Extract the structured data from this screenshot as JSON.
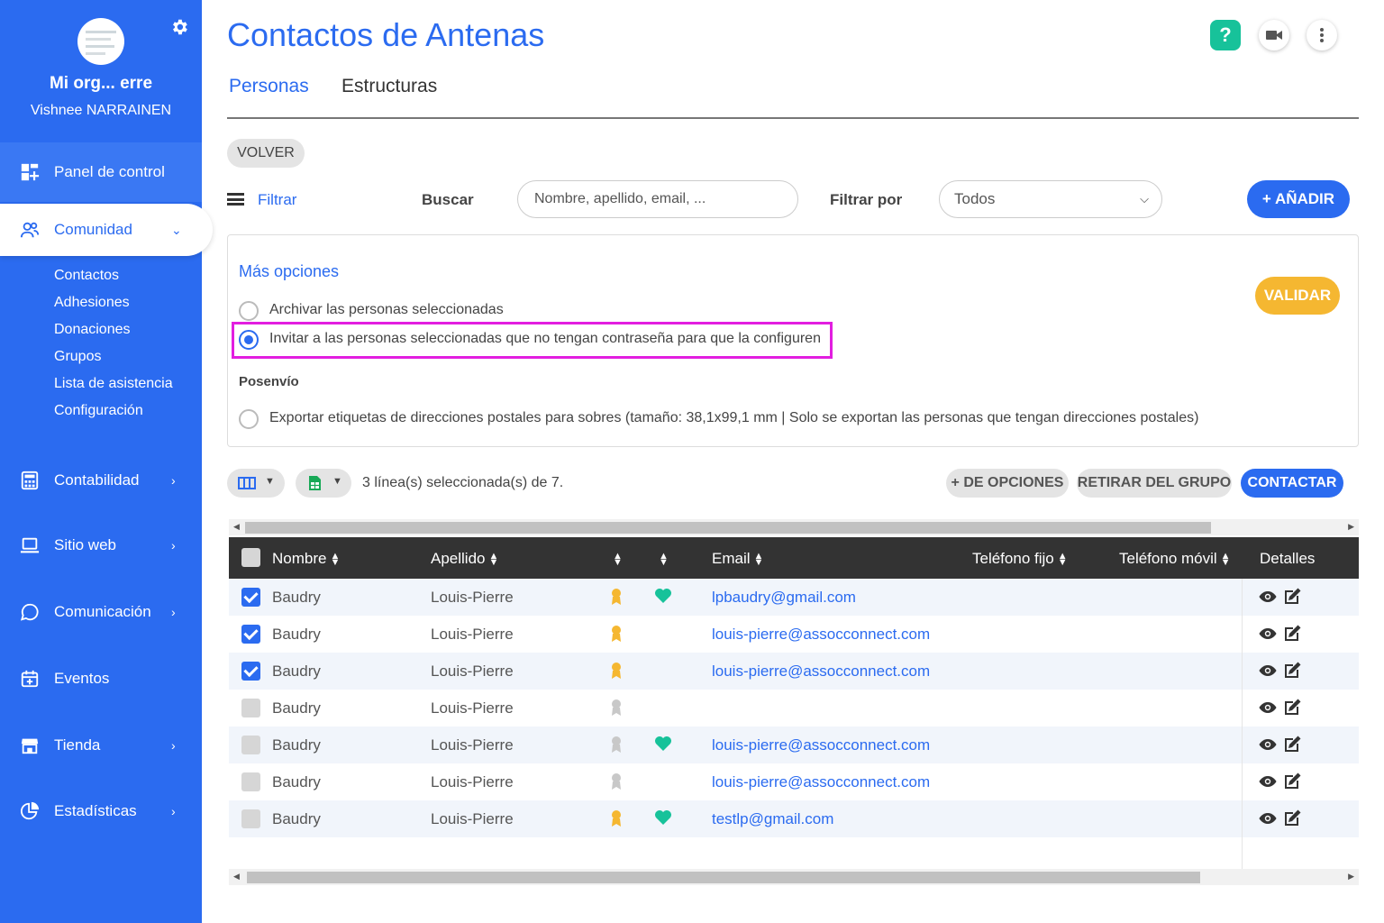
{
  "sidebar": {
    "org_name": "Mi org... erre",
    "user_name": "Vishnee NARRAINEN",
    "dashboard": "Panel de control",
    "community": "Comunidad",
    "sub_items": [
      "Contactos",
      "Adhesiones",
      "Donaciones",
      "Grupos",
      "Lista de asistencia",
      "Configuración"
    ],
    "accounting": "Contabilidad",
    "website": "Sitio web",
    "communication": "Comunicación",
    "events": "Eventos",
    "shop": "Tienda",
    "stats": "Estadísticas"
  },
  "header": {
    "title": "Contactos de Antenas",
    "help": "?"
  },
  "tabs": [
    "Personas",
    "Estructuras"
  ],
  "back_label": "VOLVER",
  "filter": {
    "toggle": "Filtrar",
    "search_label": "Buscar",
    "search_placeholder": "Nombre, apellido, email, ...",
    "filter_by_label": "Filtrar por",
    "filter_by_value": "Todos",
    "add_label": "+ AÑADIR"
  },
  "options": {
    "title": "Más opciones",
    "archive": "Archivar las personas seleccionadas",
    "invite": "Invitar a las personas seleccionadas que no tengan contraseña para que la configuren",
    "posenvio": "Posenvío",
    "export": "Exportar etiquetas de direcciones postales para sobres (tamaño: 38,1x99,1 mm | Solo se exportan las personas que tengan direcciones postales)",
    "validate": "VALIDAR"
  },
  "toolbar": {
    "selection": "3 línea(s) seleccionada(s) de 7.",
    "more_options": "+ DE OPCIONES",
    "remove_group": "RETIRAR DEL GRUPO",
    "contact": "CONTACTAR"
  },
  "table": {
    "headers": {
      "first_name": "Nombre",
      "last_name": "Apellido",
      "email": "Email",
      "phone": "Teléfono fijo",
      "mobile": "Teléfono móvil",
      "details": "Detalles"
    },
    "rows": [
      {
        "checked": true,
        "first": "Baudry",
        "last": "Louis-Pierre",
        "member": true,
        "heart": true,
        "email": "lpbaudry@gmail.com"
      },
      {
        "checked": true,
        "first": "Baudry",
        "last": "Louis-Pierre",
        "member": true,
        "heart": false,
        "email": "louis-pierre@assocconnect.com"
      },
      {
        "checked": true,
        "first": "Baudry",
        "last": "Louis-Pierre",
        "member": true,
        "heart": false,
        "email": "louis-pierre@assocconnect.com"
      },
      {
        "checked": false,
        "first": "Baudry",
        "last": "Louis-Pierre",
        "member": false,
        "heart": false,
        "email": ""
      },
      {
        "checked": false,
        "first": "Baudry",
        "last": "Louis-Pierre",
        "member": false,
        "heart": true,
        "email": "louis-pierre@assocconnect.com"
      },
      {
        "checked": false,
        "first": "Baudry",
        "last": "Louis-Pierre",
        "member": false,
        "heart": false,
        "email": "louis-pierre@assocconnect.com"
      },
      {
        "checked": false,
        "first": "Baudry",
        "last": "Louis-Pierre",
        "member": true,
        "heart": true,
        "email": "testlp@gmail.com"
      }
    ]
  },
  "colors": {
    "primary": "#2b6bf0",
    "help": "#17c29a",
    "validate": "#f5b731",
    "highlight": "#e21ee0",
    "member_active": "#f5b731",
    "member_inactive": "#c8c8c8",
    "heart": "#17c29a"
  },
  "icons": {
    "dashboard": "dashboard-icon",
    "community": "users-icon",
    "accounting": "calculator-icon",
    "website": "laptop-icon",
    "communication": "chat-icon",
    "events": "calendar-icon",
    "shop": "store-icon",
    "stats": "pie-chart-icon",
    "settings": "gear-icon",
    "video": "video-camera-icon",
    "more": "more-vertical-icon",
    "view": "eye-icon",
    "edit": "edit-icon",
    "member": "ribbon-icon",
    "donor": "heart-icon"
  }
}
